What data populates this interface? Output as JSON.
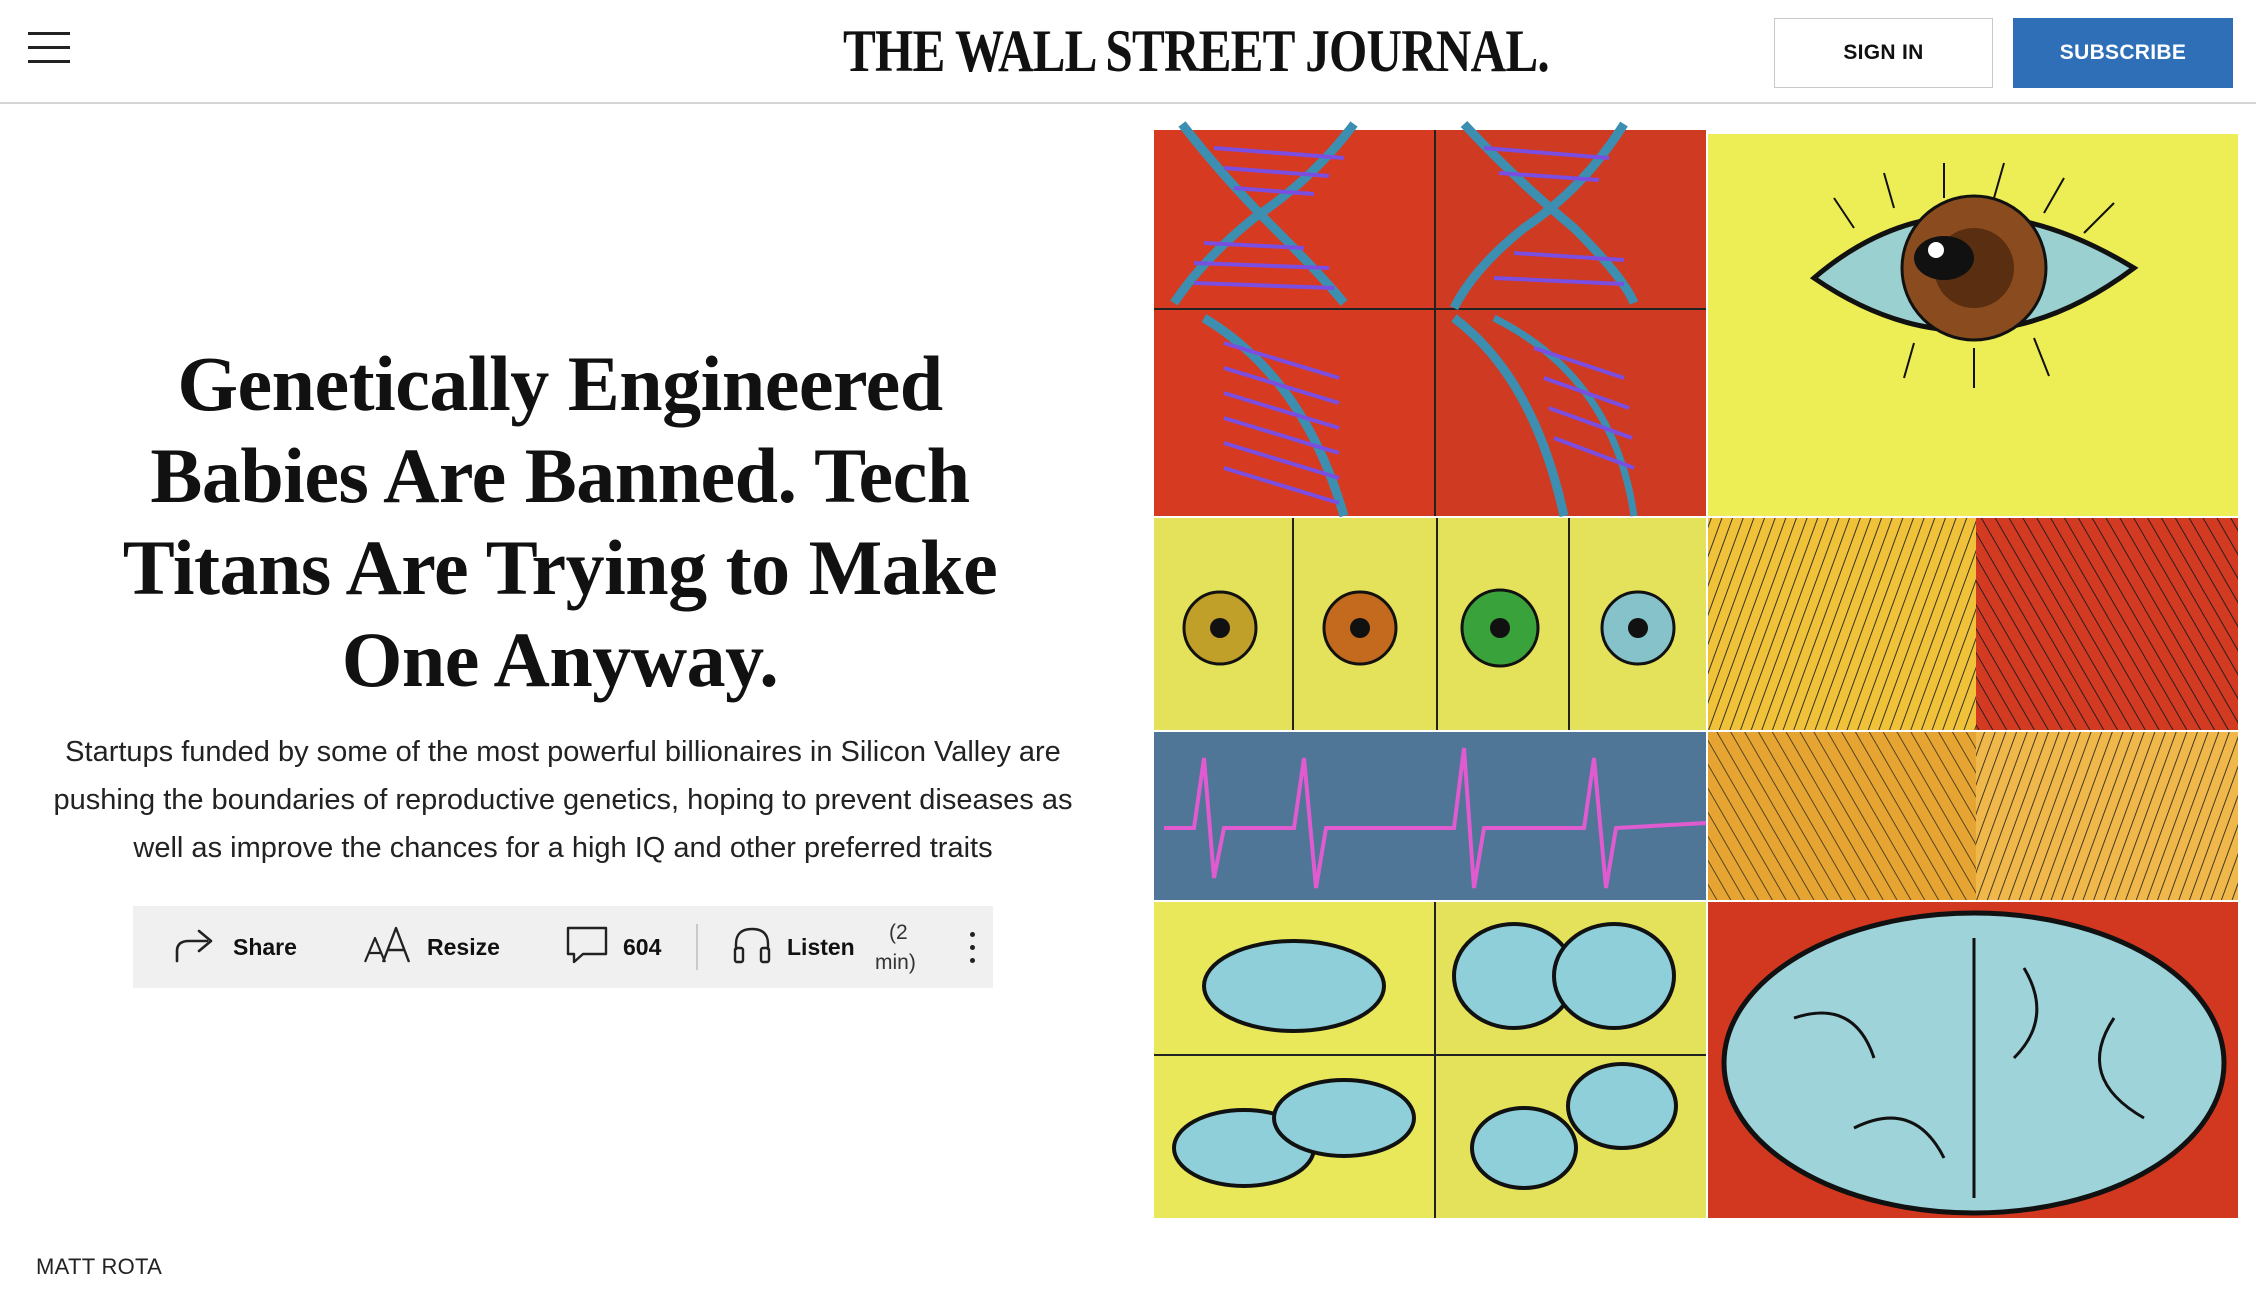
{
  "header": {
    "logo": "THE WALL STREET JOURNAL.",
    "sign_in_label": "SIGN IN",
    "subscribe_label": "SUBSCRIBE",
    "subscribe_color": "#2f6fb7"
  },
  "article": {
    "headline_lines": [
      "Genetically Engineered",
      "Babies Are Banned. Tech",
      "Titans Are Trying to Make",
      "One Anyway."
    ],
    "dek_lines": [
      "Startups funded by some of the most powerful billionaires in Silicon Valley are",
      "pushing the boundaries of reproductive genetics, hoping to prevent diseases as",
      "well as improve the chances for a high IQ and other preferred traits"
    ],
    "image_credit": "MATT ROTA"
  },
  "toolbar": {
    "share_label": "Share",
    "resize_label": "Resize",
    "comments_count": "604",
    "listen_label": "Listen",
    "listen_duration_line1": "(2",
    "listen_duration_line2": "min)"
  },
  "icons": {
    "menu": "hamburger-icon",
    "share": "share-arrow-icon",
    "resize": "text-resize-icon",
    "comments": "speech-bubble-icon",
    "listen": "headphones-icon",
    "more": "vertical-ellipsis-icon"
  },
  "illustration": {
    "description_colors": [
      "#d2381f",
      "#e7e64a",
      "#c9cf4a",
      "#4f7696",
      "#8ecfd9",
      "#e89a25"
    ]
  }
}
